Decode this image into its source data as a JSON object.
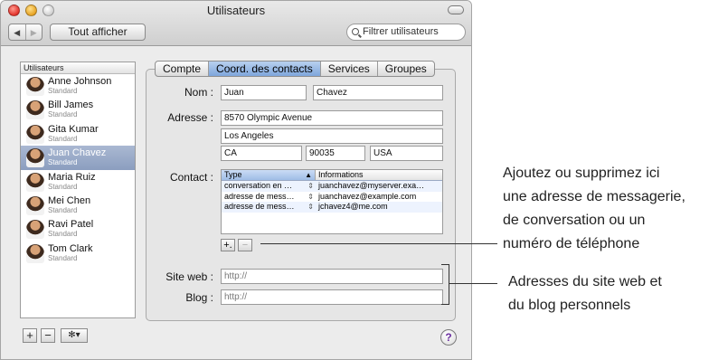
{
  "window": {
    "title": "Utilisateurs",
    "show_all_label": "Tout afficher",
    "nav_back": "◀",
    "nav_forward": "▶"
  },
  "search": {
    "placeholder": "Filtrer utilisateurs"
  },
  "users": {
    "header": "Utilisateurs",
    "items": [
      {
        "name": "Anne Johnson",
        "role": "Standard",
        "selected": false
      },
      {
        "name": "Bill James",
        "role": "Standard",
        "selected": false
      },
      {
        "name": "Gita Kumar",
        "role": "Standard",
        "selected": false
      },
      {
        "name": "Juan Chavez",
        "role": "Standard",
        "selected": true
      },
      {
        "name": "Maria Ruiz",
        "role": "Standard",
        "selected": false
      },
      {
        "name": "Mei Chen",
        "role": "Standard",
        "selected": false
      },
      {
        "name": "Ravi Patel",
        "role": "Standard",
        "selected": false
      },
      {
        "name": "Tom Clark",
        "role": "Standard",
        "selected": false
      }
    ]
  },
  "list_actions": {
    "add": "+",
    "remove": "−",
    "gear": "✻▾"
  },
  "tabs": [
    {
      "label": "Compte",
      "active": false
    },
    {
      "label": "Coord. des contacts",
      "active": true
    },
    {
      "label": "Services",
      "active": false
    },
    {
      "label": "Groupes",
      "active": false
    }
  ],
  "form": {
    "name_label": "Nom :",
    "first_name": "Juan",
    "last_name": "Chavez",
    "address_label": "Adresse :",
    "street": "8570 Olympic Avenue",
    "city": "Los Angeles",
    "state": "CA",
    "zip": "90035",
    "country": "USA",
    "contact_label": "Contact :",
    "website_label": "Site web :",
    "website_placeholder": "http://",
    "blog_label": "Blog :",
    "blog_placeholder": "http://"
  },
  "contacts": {
    "col_type": "Type",
    "col_info": "Informations",
    "rows": [
      {
        "type": "conversation en …",
        "info": "juanchavez@myserver.exa…"
      },
      {
        "type": "adresse de mess…",
        "info": "juanchavez@example.com"
      },
      {
        "type": "adresse de mess…",
        "info": "jchavez4@me.com"
      }
    ],
    "add": "+.",
    "remove": "−"
  },
  "help": "?",
  "callouts": {
    "contact_lines": [
      "Ajoutez ou supprimez ici",
      "une adresse de messagerie,",
      "de conversation ou un",
      "numéro de téléphone"
    ],
    "web_lines": [
      "Adresses du site web et",
      "du blog personnels"
    ]
  }
}
